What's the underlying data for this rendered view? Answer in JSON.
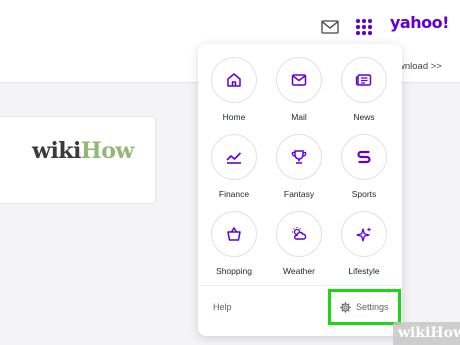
{
  "header": {
    "mail_icon": "mail-icon",
    "apps_icon": "grid-icon",
    "logo": "yahoo!",
    "download_text": "wnload >>"
  },
  "background": {
    "logo_part1": "wiki",
    "logo_part2": "How"
  },
  "apps_menu": {
    "items": [
      {
        "label": "Home",
        "icon": "home-icon"
      },
      {
        "label": "Mail",
        "icon": "mail-icon"
      },
      {
        "label": "News",
        "icon": "news-icon"
      },
      {
        "label": "Finance",
        "icon": "finance-icon"
      },
      {
        "label": "Fantasy",
        "icon": "trophy-icon"
      },
      {
        "label": "Sports",
        "icon": "sports-icon"
      },
      {
        "label": "Shopping",
        "icon": "shopping-bag-icon"
      },
      {
        "label": "Weather",
        "icon": "weather-icon"
      },
      {
        "label": "Lifestyle",
        "icon": "sparkle-icon"
      }
    ],
    "help_label": "Help",
    "settings_label": "Settings"
  },
  "watermark": {
    "part1": "wiki",
    "part2": "How"
  },
  "colors": {
    "accent": "#6001d2",
    "highlight": "#1ed618"
  }
}
